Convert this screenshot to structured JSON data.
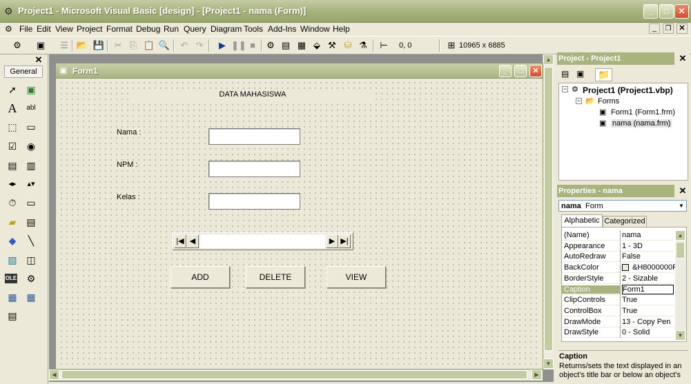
{
  "app": {
    "title": "Project1 - Microsoft Visual Basic [design] - [Project1 - nama (Form)]"
  },
  "menu": [
    "File",
    "Edit",
    "View",
    "Project",
    "Format",
    "Debug",
    "Run",
    "Query",
    "Diagram",
    "Tools",
    "Add-Ins",
    "Window",
    "Help"
  ],
  "toolbar": {
    "position": "0, 0",
    "size": "10965 x 6885"
  },
  "toolbox": {
    "tab_label": "General",
    "tools": [
      "pointer-icon",
      "picturebox-icon",
      "label-icon",
      "textbox-icon",
      "frame-icon",
      "commandbutton-icon",
      "checkbox-icon",
      "optionbutton-icon",
      "combobox-icon",
      "listbox-icon",
      "hscrollbar-icon",
      "vscrollbar-icon",
      "timer-icon",
      "drivelistbox-icon",
      "dirlistbox-icon",
      "filelistbox-icon",
      "shape-icon",
      "line-icon",
      "image-icon",
      "data-icon",
      "ole-icon",
      "addin-icon",
      "grid-icon",
      "grid2-icon",
      "dbgrid-icon"
    ]
  },
  "form": {
    "title": "Form1",
    "heading": "DATA MAHASISWA",
    "labels": {
      "nama": "Nama :",
      "npm": "NPM  :",
      "kelas": "Kelas  :"
    },
    "buttons": {
      "add": "ADD",
      "delete": "DELETE",
      "view": "VIEW"
    }
  },
  "project_panel": {
    "header": "Project - Project1",
    "root": "Project1 (Project1.vbp)",
    "folder": "Forms",
    "items": [
      "Form1 (Form1.frm)",
      "nama (nama.frm)"
    ]
  },
  "properties_panel": {
    "header": "Properties - nama",
    "object_name": "nama",
    "object_type": "Form",
    "tabs": [
      "Alphabetic",
      "Categorized"
    ],
    "rows": [
      {
        "name": "(Name)",
        "value": "nama"
      },
      {
        "name": "Appearance",
        "value": "1 - 3D"
      },
      {
        "name": "AutoRedraw",
        "value": "False"
      },
      {
        "name": "BackColor",
        "value": "&H8000000F"
      },
      {
        "name": "BorderStyle",
        "value": "2 - Sizable"
      },
      {
        "name": "Caption",
        "value": "Form1"
      },
      {
        "name": "ClipControls",
        "value": "True"
      },
      {
        "name": "ControlBox",
        "value": "True"
      },
      {
        "name": "DrawMode",
        "value": "13 - Copy Pen"
      },
      {
        "name": "DrawStyle",
        "value": "0 - Solid"
      }
    ],
    "desc_title": "Caption",
    "desc_text": "Returns/sets the text displayed in an object's title bar or below an object's"
  }
}
